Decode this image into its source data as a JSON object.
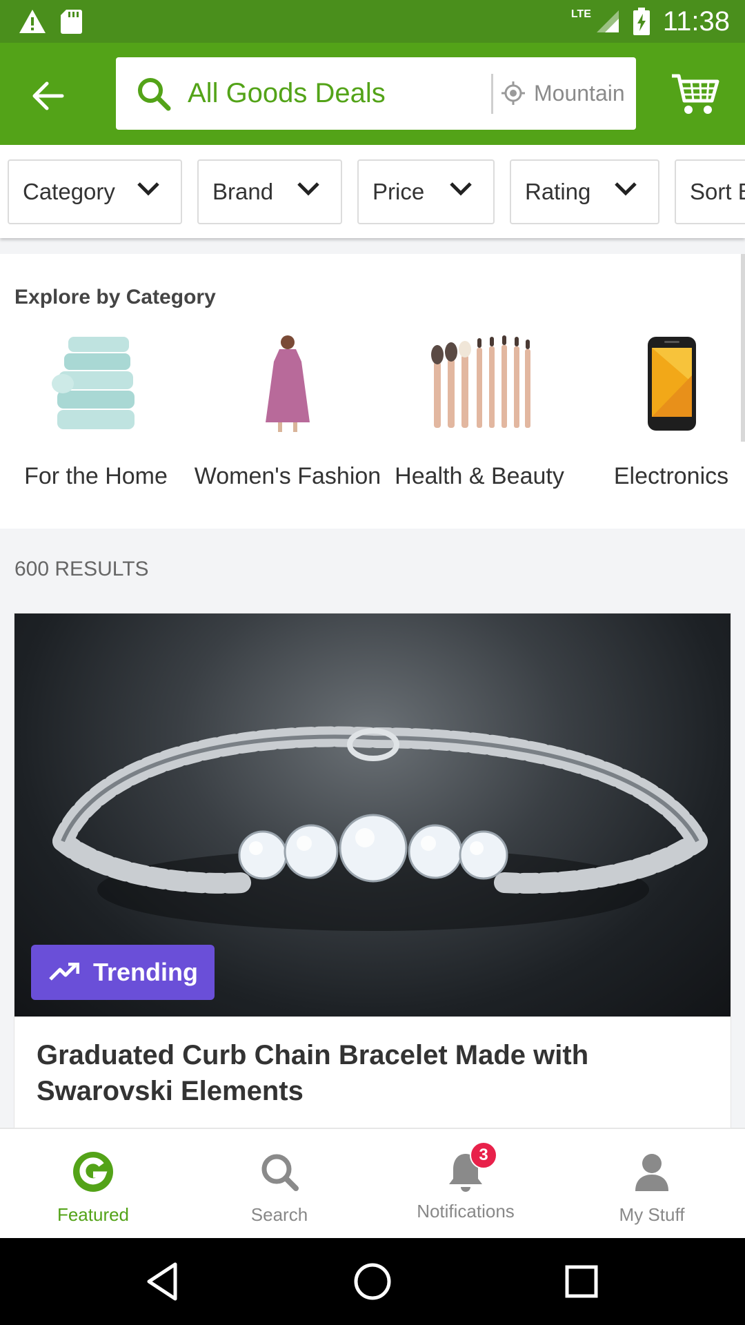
{
  "status_bar": {
    "time": "11:38",
    "network": "LTE"
  },
  "app_bar": {
    "search_text": "All Goods Deals",
    "location_text": "Mountain"
  },
  "filters": [
    {
      "label": "Category"
    },
    {
      "label": "Brand"
    },
    {
      "label": "Price"
    },
    {
      "label": "Rating"
    },
    {
      "label": "Sort B"
    }
  ],
  "explore": {
    "title": "Explore by Category",
    "categories": [
      {
        "label": "For the Home",
        "icon": "towels-image"
      },
      {
        "label": "Women's Fashion",
        "icon": "dress-image"
      },
      {
        "label": "Health & Beauty",
        "icon": "brushes-image"
      },
      {
        "label": "Electronics",
        "icon": "phone-image"
      }
    ]
  },
  "results": {
    "count": "600 RESULTS",
    "card": {
      "badge": "Trending",
      "title": "Graduated Curb Chain Bracelet Made with Swarovski Elements",
      "image": "bracelet-image"
    }
  },
  "bottom_nav": [
    {
      "label": "Featured",
      "icon": "groupon-g-icon",
      "active": true
    },
    {
      "label": "Search",
      "icon": "search-icon"
    },
    {
      "label": "Notifications",
      "icon": "bell-icon",
      "badge": "3"
    },
    {
      "label": "My Stuff",
      "icon": "person-icon"
    }
  ],
  "colors": {
    "brand_green": "#53a318",
    "status_green": "#4a8f1c",
    "trending_purple": "#6a4fd8",
    "badge_red": "#e8214a"
  }
}
